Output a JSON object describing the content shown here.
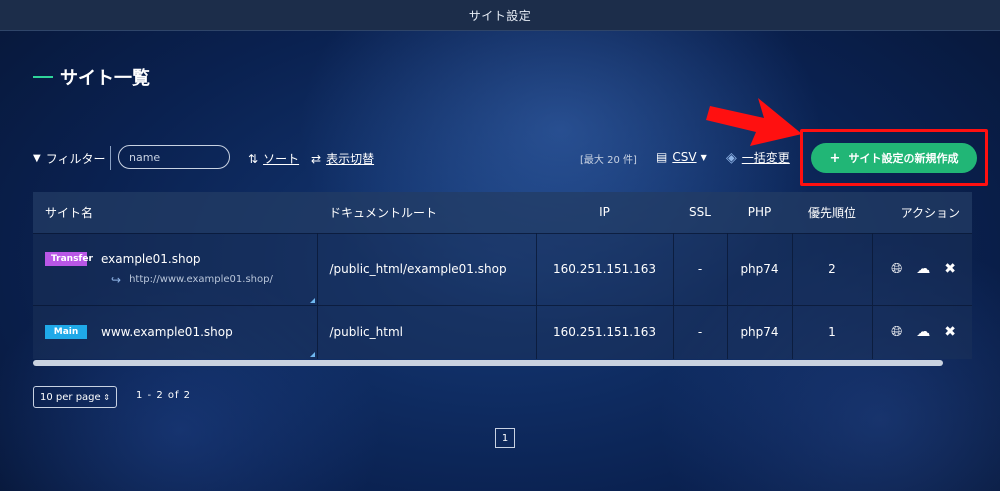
{
  "header": {
    "title": "サイト設定"
  },
  "page": {
    "title": "サイト一覧"
  },
  "toolbar": {
    "filter_label": "フィルター",
    "search_placeholder": "name",
    "sort_label": "ソート",
    "view_toggle_label": "表示切替",
    "max_label": "[最大 20 件]",
    "csv_label": "CSV",
    "bulk_change_label": "一括変更",
    "new_button_label": "サイト設定の新規作成"
  },
  "table": {
    "headers": [
      "サイト名",
      "ドキュメントルート",
      "IP",
      "SSL",
      "PHP",
      "優先順位",
      "アクション"
    ],
    "rows": [
      {
        "badge": "Transfer",
        "site": "example01.shop",
        "sub_url": "http://www.example01.shop/",
        "docroot": "/public_html/example01.shop",
        "ip": "160.251.151.163",
        "ssl": "-",
        "php": "php74",
        "priority": "2"
      },
      {
        "badge": "Main",
        "site": "www.example01.shop",
        "docroot": "/public_html",
        "ip": "160.251.151.163",
        "ssl": "-",
        "php": "php74",
        "priority": "1"
      }
    ]
  },
  "pagination": {
    "per_page": "10 per page",
    "range": "1 - 2 of 2",
    "current_page": "1"
  },
  "icons": {
    "filter": "filter-icon",
    "sort": "sort-icon",
    "toggle": "swap-icon",
    "csv": "document-icon",
    "bulk": "layers-icon",
    "plus": "plus-icon",
    "redirect": "redirect-arrow-icon",
    "globe": "globe-icon",
    "cloud": "cloud-settings-icon",
    "tools": "tools-icon"
  },
  "colors": {
    "accent_green": "#21b676",
    "title_dash": "#2fd49a",
    "highlight_red": "#ff1010",
    "badge_transfer": "#b957e6",
    "badge_main": "#1fa9e8"
  }
}
